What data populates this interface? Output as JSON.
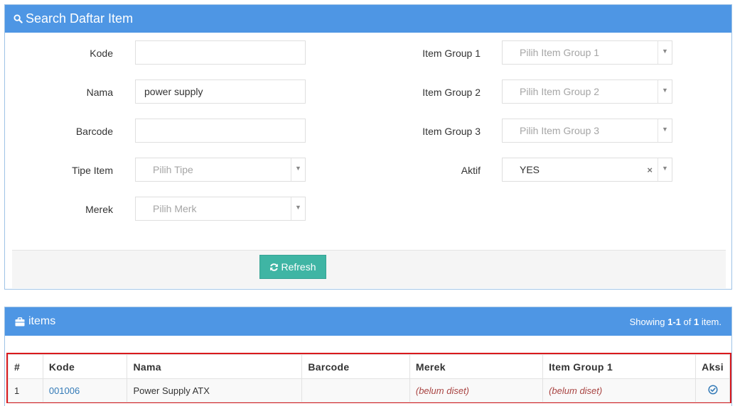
{
  "search_panel": {
    "title": "Search Daftar Item",
    "fields": {
      "kode": {
        "label": "Kode",
        "value": ""
      },
      "nama": {
        "label": "Nama",
        "value": "power supply"
      },
      "barcode": {
        "label": "Barcode",
        "value": ""
      },
      "tipe_item": {
        "label": "Tipe Item",
        "placeholder": "Pilih Tipe"
      },
      "merek": {
        "label": "Merek",
        "placeholder": "Pilih Merk"
      },
      "item_group_1": {
        "label": "Item Group 1",
        "placeholder": "Pilih Item Group 1"
      },
      "item_group_2": {
        "label": "Item Group 2",
        "placeholder": "Pilih Item Group 2"
      },
      "item_group_3": {
        "label": "Item Group 3",
        "placeholder": "Pilih Item Group 3"
      },
      "aktif": {
        "label": "Aktif",
        "value": "YES",
        "clear_symbol": "×"
      }
    },
    "refresh_label": "Refresh",
    "icons": {
      "search": "search-icon",
      "refresh": "refresh-icon"
    }
  },
  "items_panel": {
    "title": "items",
    "summary": {
      "prefix": "Showing ",
      "range": "1-1",
      "mid": " of ",
      "total": "1",
      "suffix": " item."
    },
    "columns": [
      "#",
      "Kode",
      "Nama",
      "Barcode",
      "Merek",
      "Item Group 1",
      "Aksi"
    ],
    "rows": [
      {
        "no": "1",
        "kode": "001006",
        "nama": "Power Supply ATX",
        "barcode": "",
        "merek": "(belum diset)",
        "item_group_1": "(belum diset)",
        "aksi_icon": "check-circle-icon"
      }
    ]
  },
  "colors": {
    "header_blue": "#4e96e4",
    "refresh_green": "#3fb5a4",
    "highlight_red": "#d9191d",
    "link_blue": "#337ab7",
    "unset_red": "#a94442"
  }
}
